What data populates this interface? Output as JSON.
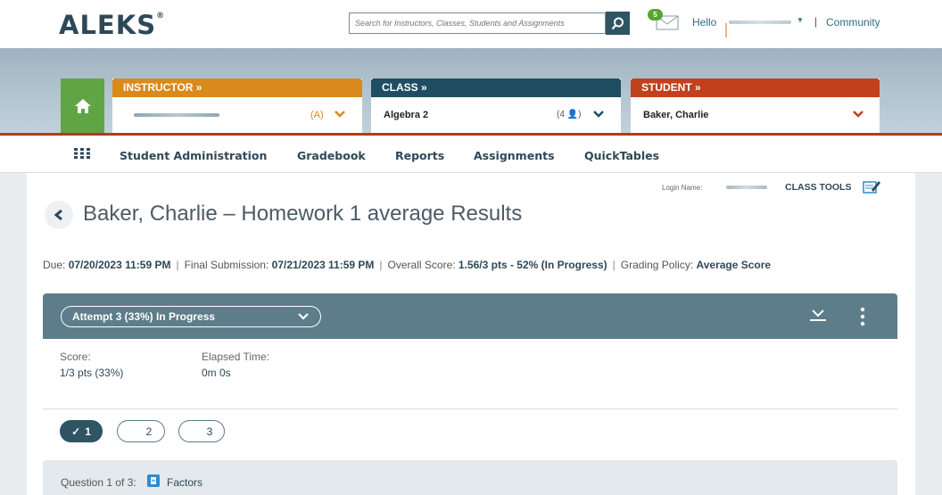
{
  "brand": {
    "logo": "ALEKS",
    "reg": "®"
  },
  "search": {
    "placeholder": "Search for Instructors, Classes, Students and Assignments"
  },
  "header": {
    "mail_count": "5",
    "hello": "Hello",
    "separator": "|",
    "community": "Community"
  },
  "context_tabs": {
    "instructor": {
      "label": "INSTRUCTOR »",
      "count": "(A)"
    },
    "class": {
      "label": "CLASS »",
      "value": "Algebra 2",
      "count": "(4 👤)"
    },
    "student": {
      "label": "STUDENT »",
      "value": "Baker, Charlie"
    }
  },
  "nav": {
    "items": [
      "Student Administration",
      "Gradebook",
      "Reports",
      "Assignments",
      "QuickTables"
    ]
  },
  "page": {
    "login_name_label": "Login Name:",
    "class_tools": "CLASS TOOLS",
    "title": "Baker, Charlie – Homework 1 average Results",
    "due_label": "Due:",
    "due_value": "07/20/2023 11:59 PM",
    "final_label": "Final Submission:",
    "final_value": "07/21/2023 11:59 PM",
    "overall_label": "Overall Score:",
    "overall_value": "1.56/3 pts - 52% (In Progress)",
    "policy_label": "Grading Policy:",
    "policy_value": "Average Score",
    "meta_sep": "|"
  },
  "attempt": {
    "selected": "Attempt 3 (33%) In Progress",
    "score_label": "Score:",
    "score_value": "1/3 pts (33%)",
    "elapsed_label": "Elapsed Time:",
    "elapsed_value": "0m 0s"
  },
  "questions": {
    "pills": [
      "1",
      "2",
      "3"
    ],
    "checkmark": "✓",
    "label": "Question 1 of 3:",
    "topic": "Factors"
  }
}
